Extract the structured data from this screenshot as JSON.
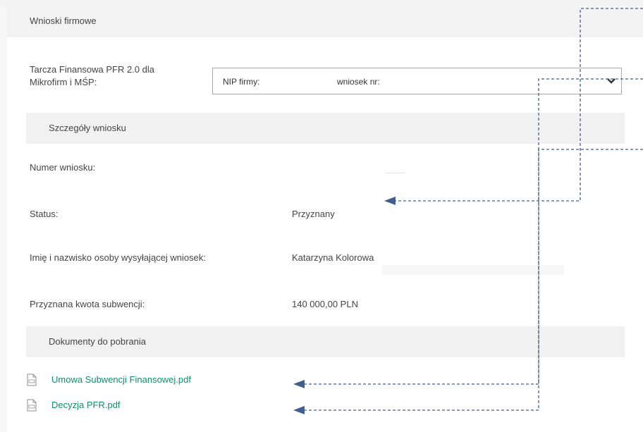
{
  "header": {
    "title": "Wnioski firmowe"
  },
  "application_select": {
    "label_line1": "Tarcza Finansowa PFR 2.0 dla",
    "label_line2": "Mikrofirm i MŚP:",
    "nip_label": "NIP firmy:",
    "wniosek_label": "wniosek nr:",
    "icon": "chevron-down-icon"
  },
  "details": {
    "section_title": "Szczegóły wniosku",
    "fields": [
      {
        "label": "Numer wniosku:",
        "value": ""
      },
      {
        "label": "Status:",
        "value": "Przyznany"
      },
      {
        "label": "Imię i nazwisko osoby wysyłającej wniosek:",
        "value": "Katarzyna Kolorowa"
      },
      {
        "label": "Przyznana kwota subwencji:",
        "value": "140 000,00 PLN"
      }
    ]
  },
  "documents": {
    "section_title": "Dokumenty do pobrania",
    "items": [
      {
        "name": "Umowa Subwencji Finansowej.pdf",
        "icon": "pdf-file-icon"
      },
      {
        "name": "Decyzja PFR.pdf",
        "icon": "pdf-file-icon"
      }
    ]
  },
  "colors": {
    "link": "#128d6e",
    "arrow": "#3f5f8f",
    "section_bg": "#f1f1f1"
  }
}
